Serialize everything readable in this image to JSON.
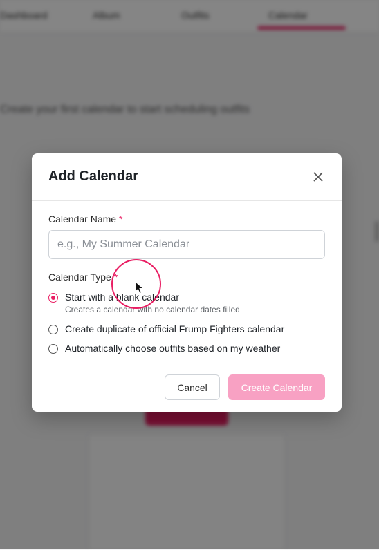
{
  "background": {
    "nav_items": [
      "Dashboard",
      "Album",
      "Outfits",
      "Calendar"
    ],
    "heading_text": "Create your first calendar to start scheduling outfits"
  },
  "modal": {
    "title": "Add Calendar",
    "close_icon": "close-icon",
    "name_field": {
      "label": "Calendar Name",
      "required_mark": "*",
      "value": "",
      "placeholder": "e.g., My Summer Calendar"
    },
    "type_field": {
      "label": "Calendar Type",
      "required_mark": "*",
      "options": [
        {
          "label": "Start with a blank calendar",
          "description": "Creates a calendar with no calendar dates filled",
          "selected": true
        },
        {
          "label": "Create duplicate of official Frump Fighters calendar",
          "selected": false
        },
        {
          "label": "Automatically choose outfits based on my weather",
          "selected": false
        }
      ]
    },
    "cancel_label": "Cancel",
    "create_label": "Create Calendar"
  },
  "colors": {
    "accent": "#e91e63",
    "create_button_disabled": "#f8a1c3",
    "overlay": "rgba(0,0,0,0.48)"
  }
}
